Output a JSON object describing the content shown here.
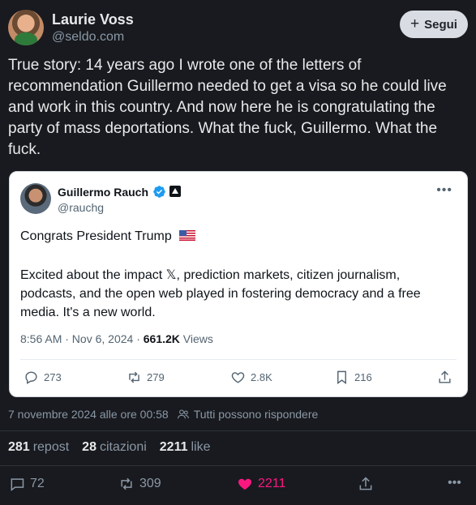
{
  "post": {
    "author_name": "Laurie Voss",
    "author_handle": "@seldo.com",
    "follow_label": "Segui",
    "text": "True story: 14 years ago I wrote one of the letters of recommendation Guillermo needed to get a visa so he could live and work in this country. And now here he is congratulating the party of mass deportations. What the fuck, Guillermo. What the fuck.",
    "timestamp": "7 novembre 2024 alle ore 00:58",
    "reply_setting": "Tutti possono rispondere",
    "stats": {
      "reposts_count": "281",
      "reposts_label": "repost",
      "quotes_count": "28",
      "quotes_label": "citazioni",
      "likes_count": "2211",
      "likes_label": "like"
    },
    "actions": {
      "replies": "72",
      "reposts": "309",
      "likes": "2211"
    }
  },
  "quoted": {
    "author_name": "Guillermo Rauch",
    "author_handle": "@rauchg",
    "line1": "Congrats President Trump",
    "body": "Excited about the impact 𝕏, prediction markets, citizen journalism, podcasts, and the open web played in fostering democracy and a free media. It's a new world.",
    "time": "8:56 AM · Nov 6, 2024 · ",
    "views_count": "661.2K",
    "views_label": "Views",
    "actions": {
      "replies": "273",
      "reposts": "279",
      "likes": "2.8K",
      "bookmarks": "216"
    }
  },
  "colors": {
    "background": "#181a1f",
    "like_active": "#f91880",
    "verified": "#1d9bf0"
  }
}
